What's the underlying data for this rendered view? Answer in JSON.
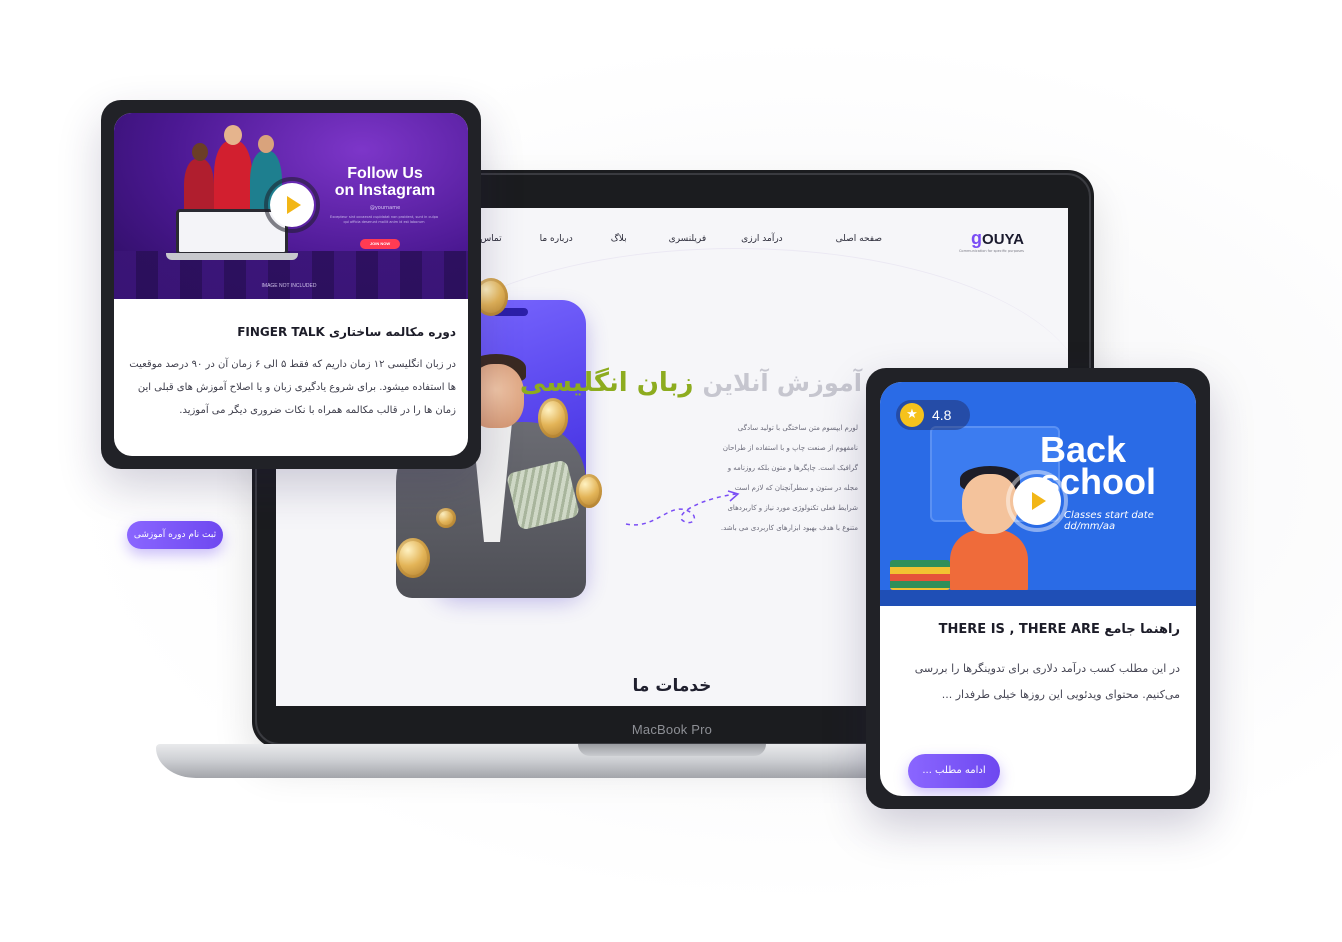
{
  "laptop": {
    "model_label": "MacBook Pro"
  },
  "site": {
    "logo_text": "OUYA",
    "logo_letter": "g",
    "logo_tagline": "Communication for specific purposes",
    "nav": [
      "صفحه اصلی",
      "درآمد ارزی",
      "فریلنسری",
      "بلاگ",
      "درباره ما",
      "تماس با ما"
    ],
    "hero_title_faded": "آموزش آنلاین",
    "hero_title": "زبان انگلیسی",
    "hero_body": "لورم ایپسوم متن ساختگی با تولید سادگی نامفهوم از صنعت چاپ و با استفاده از طراحان گرافیک است. چاپگرها و متون بلکه روزنامه و مجله در ستون و سطرآنچنان که لازم است شرایط فعلی تکنولوژی مورد نیاز و کاربردهای متنوع با هدف بهبود ابزارهای کاربردی می باشد.",
    "services_title": "خدمات ما"
  },
  "card_left": {
    "thumbnail": {
      "headline_line1": "Follow Us",
      "headline_line2": "on Instagram",
      "handle": "@yourname",
      "body": "Excepteur sint occaecat cupidatat non proident, sunt in culpa qui officia deserunt mollit anim id est laborum",
      "cta": "JOIN NOW",
      "note": "IMAGE NOT INCLUDED"
    },
    "title": "دوره مکالمه ساختاری FINGER TALK",
    "text": "در زبان انگلیسی ۱۲ زمان داریم که فقط ۵ الی ۶ زمان آن در ۹۰ درصد موقعیت ها استفاده میشود. برای شروع یادگیری زبان و یا اصلاح آموزش های قبلی این زمان ها را در قالب مکالمه همراه با نکات ضروری دیگر می آموزید.",
    "button": "ثبت نام دوره آموزشی"
  },
  "card_right": {
    "rating": "4.8",
    "thumbnail": {
      "headline_line1": "Back",
      "headline_line2": "school",
      "date_line": "Classes start date dd/mm/aa"
    },
    "title": "راهنما جامع THERE IS , THERE ARE",
    "text": "در این مطلب کسب درآمد دلاری برای تدوینگرها را بررسی می‌کنیم. محتوای ویدئویی این روزها خیلی طرفدار ...",
    "button": "ادامه مطلب ..."
  },
  "colors": {
    "accent_purple": "#7a4df5",
    "hero_green": "#8dac1f",
    "play_yellow": "#f2b616",
    "card_frame": "#212227",
    "bts_blue": "#2a6be6"
  },
  "icons": [
    "play-icon",
    "star-icon",
    "arrow-swirl-icon"
  ]
}
